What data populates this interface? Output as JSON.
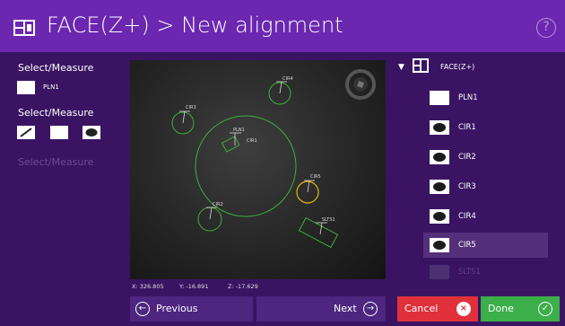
{
  "header": {
    "title": "FACE(Z+) > New alignment",
    "help_glyph": "?",
    "icon": "feature-face-icon",
    "color": "#6b27b0"
  },
  "left_panel": {
    "select_measure_1": "Select/Measure",
    "pln1_label": "PLN1",
    "select_measure_2": "Select/Measure",
    "select_measure_3": "Select/Measure",
    "tools": [
      "line-tool-icon",
      "plane-tool-icon",
      "circle-tool-icon"
    ]
  },
  "viewport": {
    "labels": {
      "cir4": "CIR4",
      "cir3": "CIR3",
      "pln1": "PLN1",
      "cir1": "CIR1",
      "cir5": "CIR5",
      "cir2": "CIR2",
      "slts1": "SLTS1"
    },
    "feature_color": "#3fae3f",
    "highlight_color": "#e6b800"
  },
  "coords": {
    "x": "X: 326.805",
    "y": "Y: -16.891",
    "z": "Z: -17.629"
  },
  "nav": {
    "previous": "Previous",
    "next": "Next",
    "cancel": "Cancel",
    "done": "Done",
    "cancel_color": "#e0313b",
    "done_color": "#3cae4a"
  },
  "tree": {
    "root_arrow": "▼",
    "root_label": "FACE(Z+)",
    "items": [
      {
        "label": "PLN1",
        "type": "plane"
      },
      {
        "label": "CIR1",
        "type": "circle"
      },
      {
        "label": "CIR2",
        "type": "circle"
      },
      {
        "label": "CIR3",
        "type": "circle"
      },
      {
        "label": "CIR4",
        "type": "circle"
      },
      {
        "label": "CIR5",
        "type": "circle",
        "selected": true
      },
      {
        "label": "SLTS1",
        "type": "slot",
        "faded": true
      }
    ]
  }
}
